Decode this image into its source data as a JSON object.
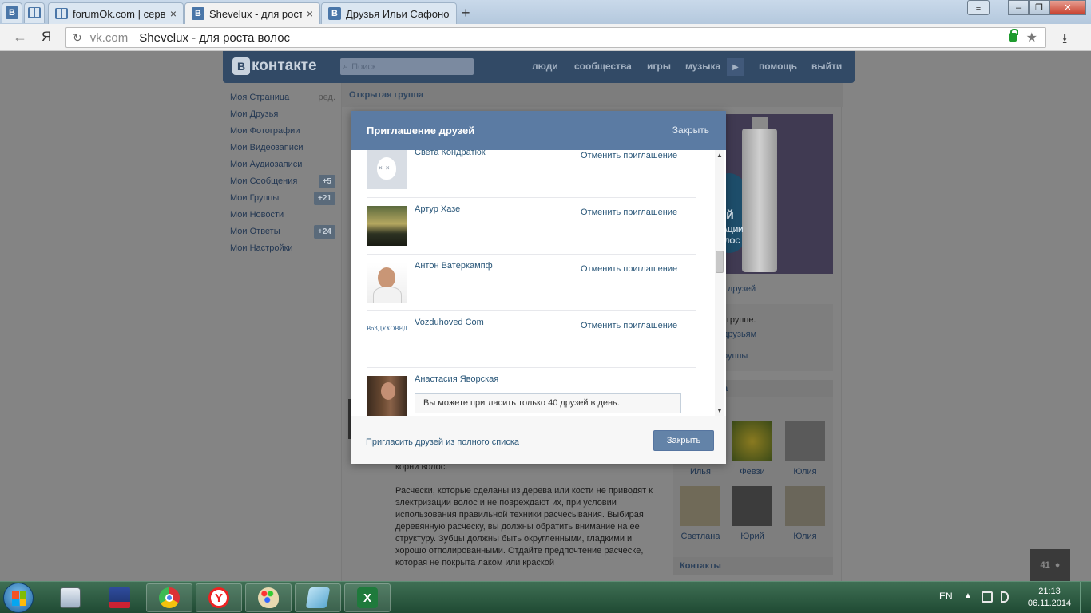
{
  "browser": {
    "tabs": [
      {
        "favicon": "vk-icon",
        "title": ""
      },
      {
        "favicon": "book-icon",
        "title": ""
      },
      {
        "favicon": "book-icon",
        "title": "forumOk.com | сервис"
      },
      {
        "favicon": "vk-icon",
        "title": "Shevelux - для роста в"
      },
      {
        "favicon": "vk-icon",
        "title": "Друзья Ильи Сафоно"
      }
    ],
    "active_tab": 3,
    "close_glyph": "×",
    "new_tab_glyph": "+",
    "back_glyph": "←",
    "yandex_glyph": "Я",
    "reload_glyph": "↻",
    "star_glyph": "★",
    "download_glyph": "⭳",
    "address": {
      "domain": "vk.com",
      "title": "Shevelux - для роста волос"
    }
  },
  "vk": {
    "logo_letter": "В",
    "logo_text": "контакте",
    "search_placeholder": "Поиск",
    "nav": [
      "люди",
      "сообщества",
      "игры",
      "музыка",
      "помощь",
      "выйти"
    ],
    "left_menu": [
      {
        "label": "Моя Страница",
        "extra": "ред.",
        "badge": ""
      },
      {
        "label": "Мои Друзья",
        "extra": "",
        "badge": ""
      },
      {
        "label": "Мои Фотографии",
        "extra": "",
        "badge": ""
      },
      {
        "label": "Мои Видеозаписи",
        "extra": "",
        "badge": ""
      },
      {
        "label": "Мои Аудиозаписи",
        "extra": "",
        "badge": ""
      },
      {
        "label": "Мои Сообщения",
        "extra": "",
        "badge": "+5"
      },
      {
        "label": "Мои Группы",
        "extra": "",
        "badge": "+21"
      },
      {
        "label": "Мои Новости",
        "extra": "",
        "badge": ""
      },
      {
        "label": "Мои Ответы",
        "extra": "",
        "badge": "+24"
      },
      {
        "label": "Мои Настройки",
        "extra": "",
        "badge": ""
      }
    ],
    "group_label": "Открытая группа",
    "article": [
      "корни волос.",
      "Расчески, которые сделаны из дерева или кости не приводят к электризации волос и не повреждают их, при условии использования правильной техники расчесывания. Выбирая деревянную расческу, вы должны обратить внимание на ее структуру. Зубцы должны быть округленными, гладкими и хорошо отполированными. Отдайте предпочтение расческе, которая не покрыта лаком или краской"
    ],
    "side": {
      "ad_text": [
        "й",
        "ЗАЦИИ",
        "ЛОС"
      ],
      "invite_link": "друзей",
      "info_lines": [
        "в группе.",
        "друзьям",
        "руппы"
      ],
      "members_head": "а",
      "friends": [
        "Илья",
        "Февзи",
        "Юлия",
        "Светлана",
        "Юрий",
        "Юлия"
      ],
      "contacts_head": "Контакты"
    },
    "counter": "41"
  },
  "modal": {
    "title": "Приглашение друзей",
    "close_link": "Закрыть",
    "rows": [
      {
        "name": "Света Кондратюк",
        "action": "Отменить приглашение",
        "avatar": "deactivated-dog-avatar"
      },
      {
        "name": "Артур Хазе",
        "action": "Отменить приглашение",
        "avatar": "landscape-avatar"
      },
      {
        "name": "Антон Ватеркампф",
        "action": "Отменить приглашение",
        "avatar": "man-avatar"
      },
      {
        "name": "Vozduhoved Com",
        "action": "Отменить приглашение",
        "avatar": "logo-avatar"
      },
      {
        "name": "Анастасия Яворская",
        "action": "",
        "avatar": "woman-horse-avatar"
      }
    ],
    "logo_avatar_text": "ВоЗДУХОВЕД",
    "notice": "Вы можете пригласить только 40 друзей в день.",
    "footer_link": "Пригласить друзей из полного списка",
    "footer_button": "Закрыть",
    "scroll_up_glyph": "▲",
    "scroll_down_glyph": "▼"
  },
  "taskbar": {
    "apps": [
      "calculator-icon",
      "floppy-icon",
      "chrome-icon",
      "yandex-browser-icon",
      "paint-icon",
      "notepad-icon",
      "excel-icon"
    ],
    "lang": "EN",
    "tray_up": "▲",
    "time": "21:13",
    "date": "06.11.2014"
  },
  "colors": {
    "vk_header": "#5b7ba3",
    "vk_link": "#2b587a",
    "vk_button": "#6383a8",
    "taskbar": "#2a5a40"
  }
}
